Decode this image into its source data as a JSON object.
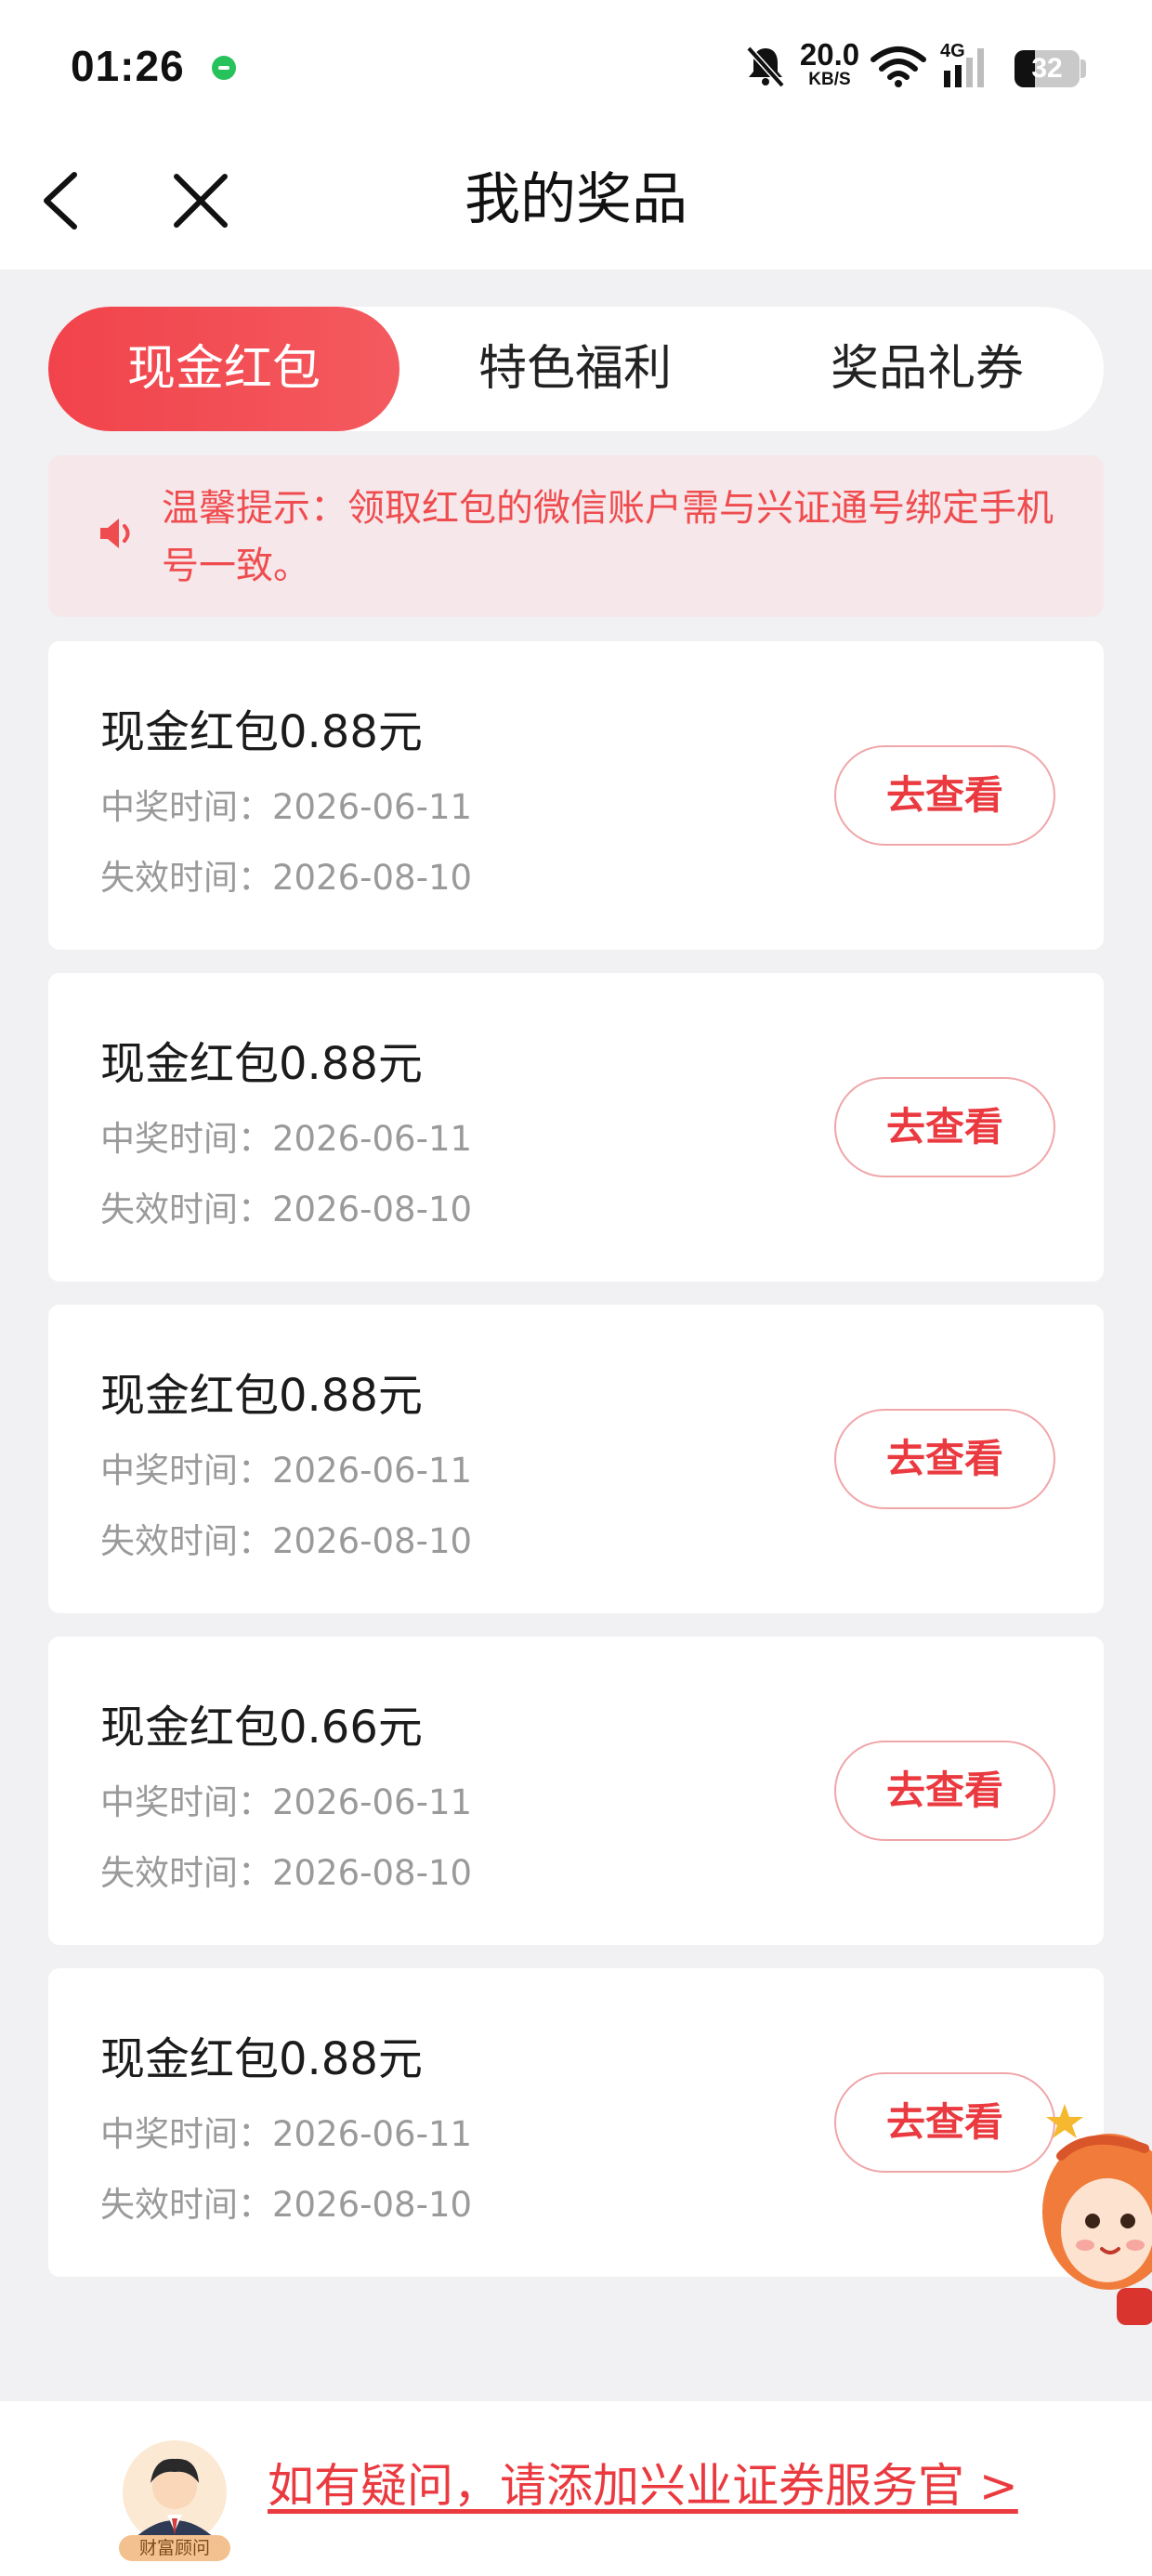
{
  "status_bar": {
    "time": "01:26",
    "net_speed": "20.0",
    "net_speed_unit": "KB/S",
    "cell_label": "4G",
    "battery": "32",
    "battery_level": 0.32
  },
  "nav": {
    "title": "我的奖品"
  },
  "tabs": [
    {
      "label": "现金红包",
      "active": true
    },
    {
      "label": "特色福利",
      "active": false
    },
    {
      "label": "奖品礼券",
      "active": false
    }
  ],
  "notice": {
    "text": "温馨提示：领取红包的微信账户需与兴证通号绑定手机号一致。"
  },
  "prizes": [
    {
      "name": "现金红包0.88元",
      "win_time": "中奖时间：2026-06-11",
      "expire_time": "失效时间：2026-08-10",
      "button": "去查看"
    },
    {
      "name": "现金红包0.88元",
      "win_time": "中奖时间：2026-06-11",
      "expire_time": "失效时间：2026-08-10",
      "button": "去查看"
    },
    {
      "name": "现金红包0.88元",
      "win_time": "中奖时间：2026-06-11",
      "expire_time": "失效时间：2026-08-10",
      "button": "去查看"
    },
    {
      "name": "现金红包0.66元",
      "win_time": "中奖时间：2026-06-11",
      "expire_time": "失效时间：2026-08-10",
      "button": "去查看"
    },
    {
      "name": "现金红包0.88元",
      "win_time": "中奖时间：2026-06-11",
      "expire_time": "失效时间：2026-08-10",
      "button": "去查看"
    }
  ],
  "footer": {
    "avatar_badge": "财富顾问",
    "link": "如有疑问，请添加兴业证券服务官 >"
  },
  "colors": {
    "accent": "#ea3a40",
    "tab_active": "#f2434b",
    "notice_bg": "#f6e7ea",
    "page_bg": "#f1f1f3"
  },
  "icons": [
    "back-icon",
    "close-icon",
    "speaker-icon",
    "mute-icon",
    "wifi-icon",
    "cell-signal-icon",
    "battery-icon",
    "mascot-icon",
    "advisor-avatar"
  ]
}
